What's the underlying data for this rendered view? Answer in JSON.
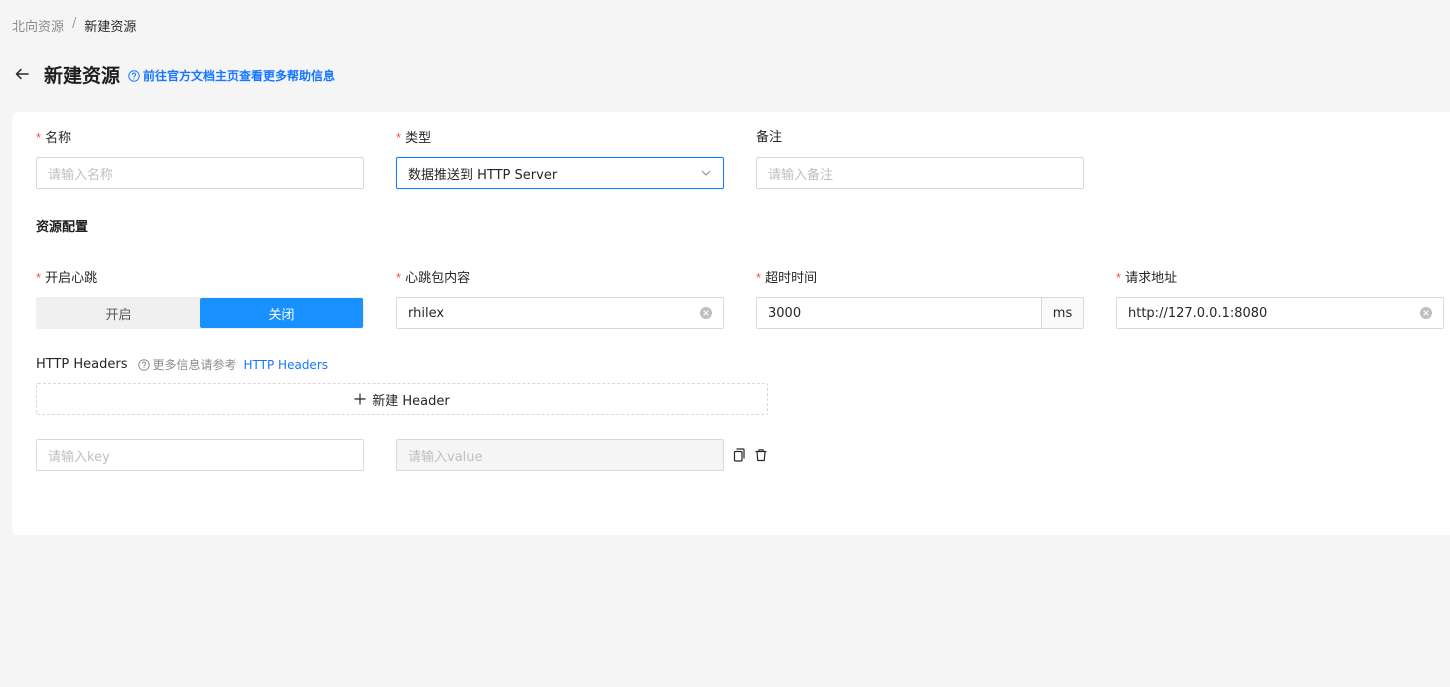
{
  "breadcrumb": {
    "parent": "北向资源",
    "separator": "/",
    "current": "新建资源"
  },
  "header": {
    "title": "新建资源",
    "help_text": "前往官方文档主页查看更多帮助信息"
  },
  "form": {
    "name": {
      "label": "名称",
      "required_mark": "*",
      "placeholder": "请输入名称"
    },
    "type": {
      "label": "类型",
      "required_mark": "*",
      "value": "数据推送到 HTTP Server"
    },
    "remark": {
      "label": "备注",
      "placeholder": "请输入备注"
    },
    "section_title": "资源配置",
    "heartbeat": {
      "label": "开启心跳",
      "required_mark": "*",
      "options": [
        "开启",
        "关闭"
      ],
      "selected": "关闭"
    },
    "heartbeat_content": {
      "label": "心跳包内容",
      "required_mark": "*",
      "value": "rhilex"
    },
    "timeout": {
      "label": "超时时间",
      "required_mark": "*",
      "value": "3000",
      "unit": "ms"
    },
    "url": {
      "label": "请求地址",
      "required_mark": "*",
      "value": "http://127.0.0.1:8080"
    },
    "http_headers": {
      "title": "HTTP Headers",
      "hint": "更多信息请参考",
      "hint_link": "HTTP Headers",
      "add_button": "新建 Header",
      "key_placeholder": "请输入key",
      "value_placeholder": "请输入value"
    }
  },
  "colors": {
    "primary": "#1890ff",
    "link": "#1677ff",
    "required": "#ff4d4f"
  },
  "icons": [
    "arrow-left-icon",
    "question-circle-icon",
    "chevron-down-icon",
    "close-circle-icon",
    "plus-icon",
    "copy-icon",
    "delete-icon"
  ]
}
